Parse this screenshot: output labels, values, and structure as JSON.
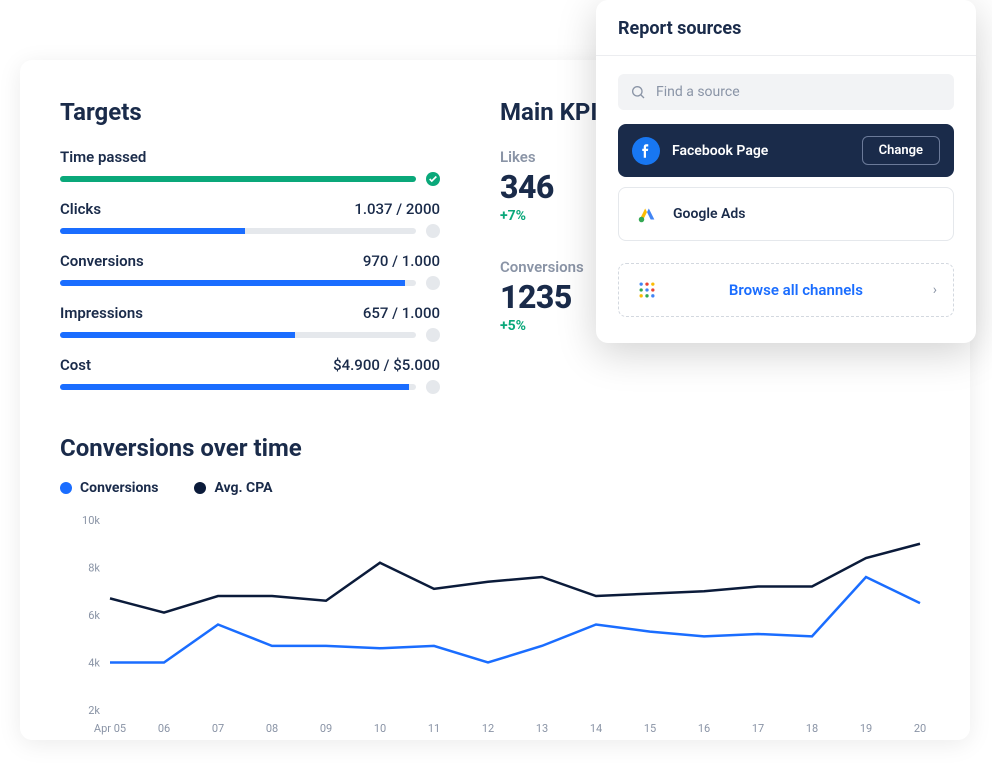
{
  "colors": {
    "blue": "#1a6dff",
    "navy": "#1a2b4a",
    "green": "#0aa87a",
    "grey": "#e5e8ec"
  },
  "targets": {
    "title": "Targets",
    "items": [
      {
        "label": "Time passed",
        "value": "",
        "pct": 100,
        "color": "green",
        "done": true
      },
      {
        "label": "Clicks",
        "value": "1.037  / 2000",
        "pct": 52,
        "color": "blue",
        "done": false
      },
      {
        "label": "Conversions",
        "value": "970 / 1.000",
        "pct": 97,
        "color": "blue",
        "done": false
      },
      {
        "label": "Impressions",
        "value": "657 / 1.000",
        "pct": 66,
        "color": "blue",
        "done": false
      },
      {
        "label": "Cost",
        "value": "$4.900 / $5.000",
        "pct": 98,
        "color": "blue",
        "done": false
      }
    ]
  },
  "kpis": {
    "title": "Main KPI",
    "items": [
      {
        "label": "Likes",
        "value": "346",
        "delta": "+7%"
      },
      {
        "label": "Conversions",
        "value": "1235",
        "delta": "+5%"
      }
    ]
  },
  "chart": {
    "title": "Conversions over time",
    "legend": [
      {
        "label": "Conversions",
        "color": "#1a6dff"
      },
      {
        "label": "Avg. CPA",
        "color": "#0b1b3a"
      }
    ]
  },
  "chart_data": {
    "type": "line",
    "xlabel": "",
    "ylabel": "",
    "ylim": [
      2000,
      10000
    ],
    "y_ticks": [
      "10k",
      "8k",
      "6k",
      "4k",
      "2k"
    ],
    "categories": [
      "Apr 05",
      "06",
      "07",
      "08",
      "09",
      "10",
      "11",
      "12",
      "13",
      "14",
      "15",
      "16",
      "17",
      "18",
      "19",
      "20"
    ],
    "series": [
      {
        "name": "Conversions",
        "color": "#1a6dff",
        "values": [
          4000,
          4000,
          5600,
          4700,
          4700,
          4600,
          4700,
          4000,
          4700,
          5600,
          5300,
          5100,
          5200,
          5100,
          7600,
          6500
        ]
      },
      {
        "name": "Avg. CPA",
        "color": "#0b1b3a",
        "values": [
          6700,
          6100,
          6800,
          6800,
          6600,
          8200,
          7100,
          7400,
          7600,
          6800,
          6900,
          7000,
          7200,
          7200,
          8400,
          9000
        ]
      }
    ]
  },
  "sources": {
    "title": "Report sources",
    "search_placeholder": "Find a source",
    "items": [
      {
        "name": "Facebook Page",
        "selected": true,
        "action": "Change",
        "icon": "facebook"
      },
      {
        "name": "Google Ads",
        "selected": false,
        "icon": "google-ads"
      }
    ],
    "browse": "Browse all channels"
  }
}
